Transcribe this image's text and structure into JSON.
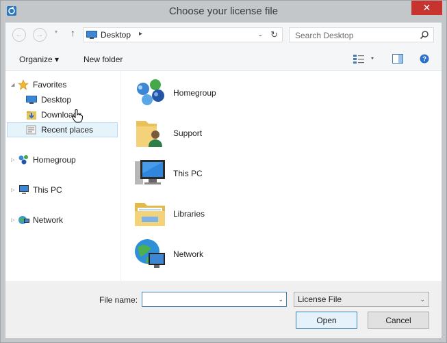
{
  "window": {
    "title": "Choose your license file",
    "close_glyph": "✕"
  },
  "nav": {
    "back_glyph": "←",
    "forward_glyph": "→",
    "recent_glyph": "▾",
    "up_glyph": "↑",
    "address": {
      "location": "Desktop",
      "chevron": "▸",
      "dropdown": "⌄",
      "refresh": "↻"
    },
    "search_placeholder": "Search Desktop"
  },
  "toolbar": {
    "organize": "Organize ▾",
    "new_folder": "New folder"
  },
  "sidebar": {
    "items": [
      {
        "label": "Favorites",
        "icon": "star-icon",
        "expander": "◢"
      },
      {
        "label": "Desktop",
        "icon": "desktop-icon"
      },
      {
        "label": "Downloads",
        "icon": "downloads-icon"
      },
      {
        "label": "Recent places",
        "icon": "recent-places-icon",
        "selected": true
      },
      {
        "label": "Homegroup",
        "icon": "homegroup-icon",
        "expander": "▷"
      },
      {
        "label": "This PC",
        "icon": "computer-icon",
        "expander": "▷"
      },
      {
        "label": "Network",
        "icon": "network-icon",
        "expander": "▷"
      }
    ]
  },
  "content": {
    "items": [
      {
        "label": "Homegroup",
        "icon": "homegroup-icon"
      },
      {
        "label": "Support",
        "icon": "user-folder-icon"
      },
      {
        "label": "This PC",
        "icon": "computer-icon"
      },
      {
        "label": "Libraries",
        "icon": "libraries-icon"
      },
      {
        "label": "Network",
        "icon": "network-icon"
      }
    ]
  },
  "footer": {
    "file_name_label": "File name:",
    "file_name_value": "",
    "file_type": "License File",
    "open_label": "Open",
    "cancel_label": "Cancel",
    "dropdown_glyph": "⌄"
  },
  "colors": {
    "accent": "#3c7fb1",
    "selection": "#e5f3fb",
    "close": "#c7332f"
  }
}
